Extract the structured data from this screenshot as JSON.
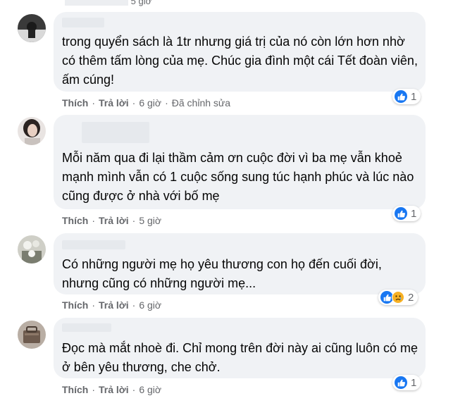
{
  "top_partial": {
    "time": "5 giờ"
  },
  "actions": {
    "like": "Thích",
    "reply": "Trả lời",
    "separator": "·"
  },
  "comments": [
    {
      "text": "trong quyển sách là 1tr nhưng giá trị của nó còn lớn hơn nhờ có thêm tấm lòng của mẹ. Chúc gia đình một cái Tết đoàn viên, ấm cúng!",
      "time": "6 giờ",
      "edited": "Đã chỉnh sửa",
      "reactions": {
        "icons": [
          "like-icon"
        ],
        "count": "1"
      }
    },
    {
      "text": "Mỗi năm qua đi lại thầm cảm ơn cuộc đời vì ba mẹ vẫn khoẻ mạnh mình vẫn có 1 cuộc sống sung túc hạnh phúc và lúc nào cũng được ở nhà với bố mẹ",
      "time": "5 giờ",
      "reactions": {
        "icons": [
          "like-icon"
        ],
        "count": "1"
      }
    },
    {
      "text": "Có những người mẹ họ yêu thương con họ đến cuối đời, nhưng cũng có những người mẹ...",
      "time": "6 giờ",
      "reactions": {
        "icons": [
          "like-icon",
          "sad-icon"
        ],
        "count": "2"
      }
    },
    {
      "text": "Đọc mà mắt nhoè đi. Chỉ mong trên đời này ai cũng luôn có mẹ ở bên yêu thương, che chở.",
      "time": "6 giờ",
      "reactions": {
        "icons": [
          "like-icon"
        ],
        "count": "1"
      }
    }
  ],
  "colors": {
    "bubble": "#f0f2f5",
    "meta": "#65676b",
    "like": "#1877f2",
    "sad": "#f7b125"
  }
}
